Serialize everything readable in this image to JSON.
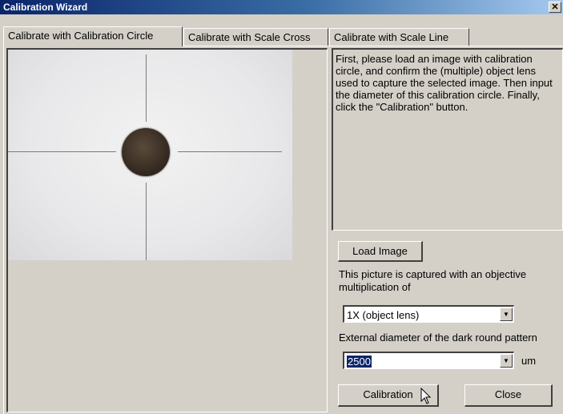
{
  "window": {
    "title": "Calibration Wizard",
    "close_glyph": "✕"
  },
  "tabs": [
    {
      "label": "Calibrate with Calibration Circle",
      "active": true
    },
    {
      "label": "Calibrate with Scale Cross",
      "active": false
    },
    {
      "label": "Calibrate with Scale Line",
      "active": false
    }
  ],
  "instructions": "First, please load an image with calibration circle, and confirm the (multiple) object lens used to capture the selected image.  Then input the diameter of this calibration circle. Finally, click the \"Calibration\" button.",
  "controls": {
    "load_image_label": "Load Image",
    "objective_label": "This picture is captured with an objective multiplication of",
    "objective_value": "1X (object lens)",
    "diameter_label": "External diameter of the dark round pattern",
    "diameter_value": "2500",
    "unit_label": "um",
    "calibration_label": "Calibration",
    "close_label": "Close"
  },
  "icons": {
    "dropdown_arrow": "▼",
    "cursor": "mouse-pointer-icon"
  }
}
